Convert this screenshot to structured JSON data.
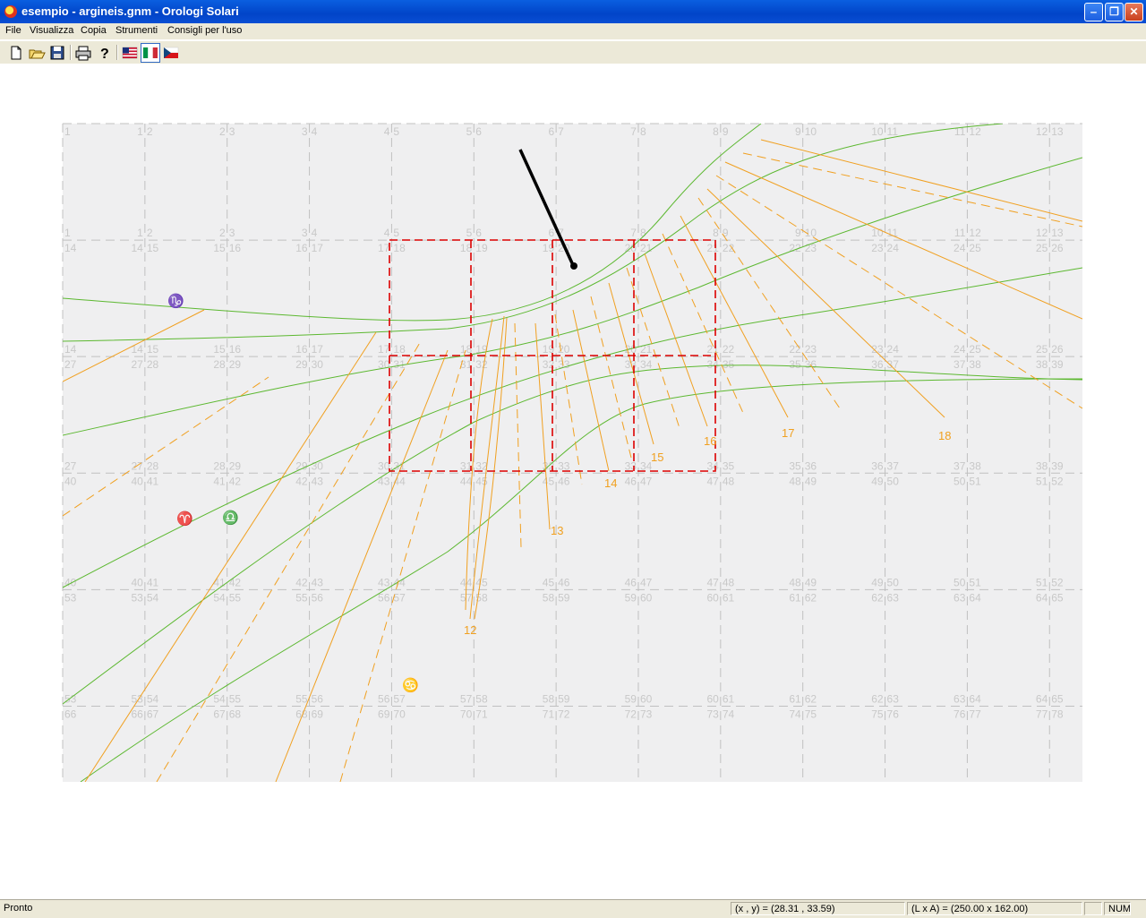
{
  "window": {
    "title": "esempio - argineis.gnm - Orologi Solari",
    "minimize_glyph": "‒",
    "maximize_glyph": "❐",
    "close_glyph": "✕"
  },
  "menu": [
    "File",
    "Visualizza",
    "Copia",
    "Strumenti",
    "Consigli per l'uso"
  ],
  "toolbar": {
    "buttons": [
      "new-document-icon",
      "open-folder-icon",
      "save-disk-icon",
      "print-icon",
      "help-icon",
      "flag-us-icon",
      "flag-it-icon",
      "flag-cz-icon"
    ]
  },
  "diagram": {
    "hour_labels": [
      "12",
      "13",
      "14",
      "15",
      "16",
      "17",
      "18"
    ],
    "sign_symbols": {
      "capricorn": "♑",
      "aries": "♈",
      "libra": "♎",
      "cancer": "♋"
    },
    "colors": {
      "hour_lines": "#f0a020",
      "date_lines": "#5cb830",
      "grid": "#c0c0c0",
      "grid_numbers": "#c8c8c8",
      "selection": "#dd0000",
      "background": "#efeff0",
      "gnomon": "#000000"
    },
    "grid_number_start": 1,
    "grid_columns": 13,
    "grid_rows": 6
  },
  "status": {
    "state": "Pronto",
    "coords": "(x , y) = (28.31 , 33.59)",
    "size": "(L x A) = (250.00 x 162.00)",
    "num": "NUM"
  }
}
